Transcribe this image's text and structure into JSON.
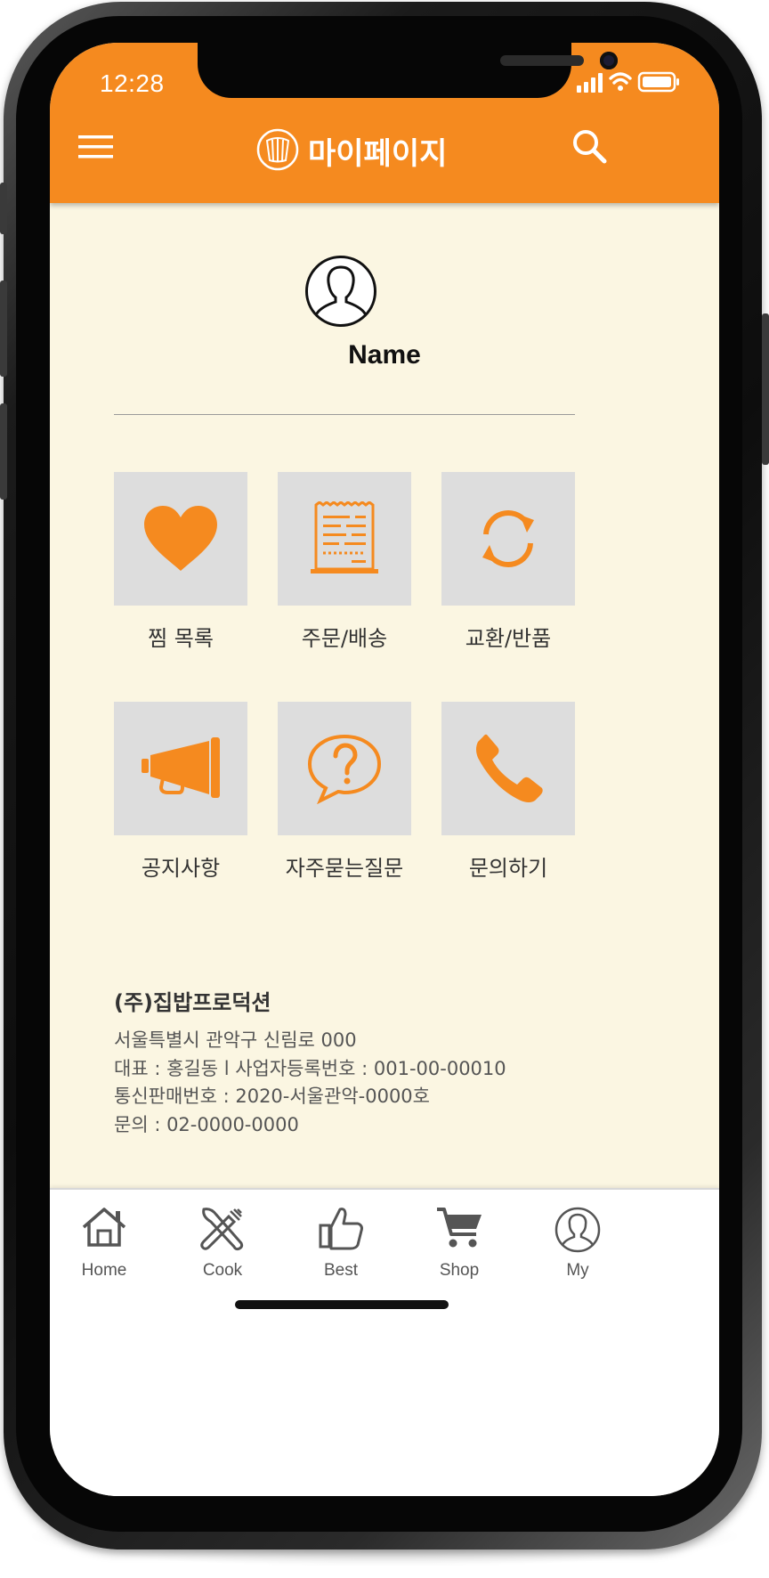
{
  "status_bar": {
    "time": "12:28"
  },
  "header": {
    "title": "마이페이지"
  },
  "profile": {
    "name": "Name"
  },
  "menu": [
    {
      "label": "찜 목록",
      "icon": "heart-icon"
    },
    {
      "label": "주문/배송",
      "icon": "receipt-icon"
    },
    {
      "label": "교환/반품",
      "icon": "refresh-icon"
    },
    {
      "label": "공지사항",
      "icon": "megaphone-icon"
    },
    {
      "label": "자주묻는질문",
      "icon": "question-bubble-icon"
    },
    {
      "label": "문의하기",
      "icon": "phone-icon"
    }
  ],
  "company": {
    "name": "(주)집밥프로덕션",
    "address": "서울특별시 관악구 신림로 000",
    "ceo_reg": "대표 : 홍길동 l 사업자등록번호 : 001-00-00010",
    "mail_order": "통신판매번호 :  2020-서울관악-0000호",
    "contact": "문의 : 02-0000-0000"
  },
  "tabs": [
    {
      "label": "Home",
      "icon": "home-icon"
    },
    {
      "label": "Cook",
      "icon": "utensils-icon"
    },
    {
      "label": "Best",
      "icon": "thumbs-up-icon"
    },
    {
      "label": "Shop",
      "icon": "cart-icon"
    },
    {
      "label": "My",
      "icon": "user-icon"
    }
  ],
  "colors": {
    "accent": "#f58a1f",
    "background": "#fbf6e2",
    "tile": "#dddddd"
  }
}
